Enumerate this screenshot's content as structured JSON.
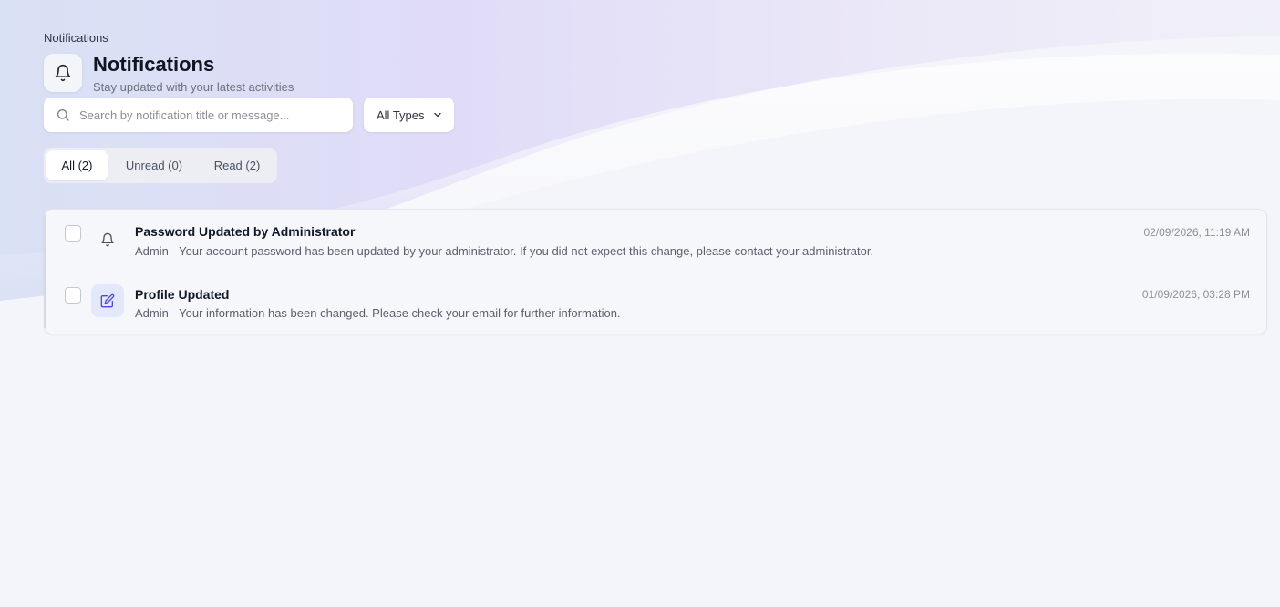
{
  "breadcrumb": "Notifications",
  "header": {
    "title": "Notifications",
    "subtitle": "Stay updated with your latest activities",
    "icon": "bell-icon"
  },
  "search": {
    "placeholder": "Search by notification title or message...",
    "value": "",
    "icon": "search-icon"
  },
  "type_filter": {
    "selected": "All Types",
    "icon": "chevron-down-icon"
  },
  "tabs": [
    {
      "label": "All (2)",
      "active": true
    },
    {
      "label": "Unread (0)",
      "active": false
    },
    {
      "label": "Read (2)",
      "active": false
    }
  ],
  "notifications": [
    {
      "title": "Password Updated by Administrator",
      "message": "Admin - Your account password has been updated by your administrator. If you did not expect this change, please contact your administrator.",
      "time": "02/09/2026, 11:19 AM",
      "icon": "bell-icon",
      "checked": false
    },
    {
      "title": "Profile Updated",
      "message": "Admin - Your information has been changed. Please check your email for further information.",
      "time": "01/09/2026, 03:28 PM",
      "icon": "edit-icon",
      "checked": false
    }
  ],
  "colors": {
    "accent": "#4f46e5",
    "background": "#f4f5fa",
    "header_gradient": "#dcd8f7"
  }
}
